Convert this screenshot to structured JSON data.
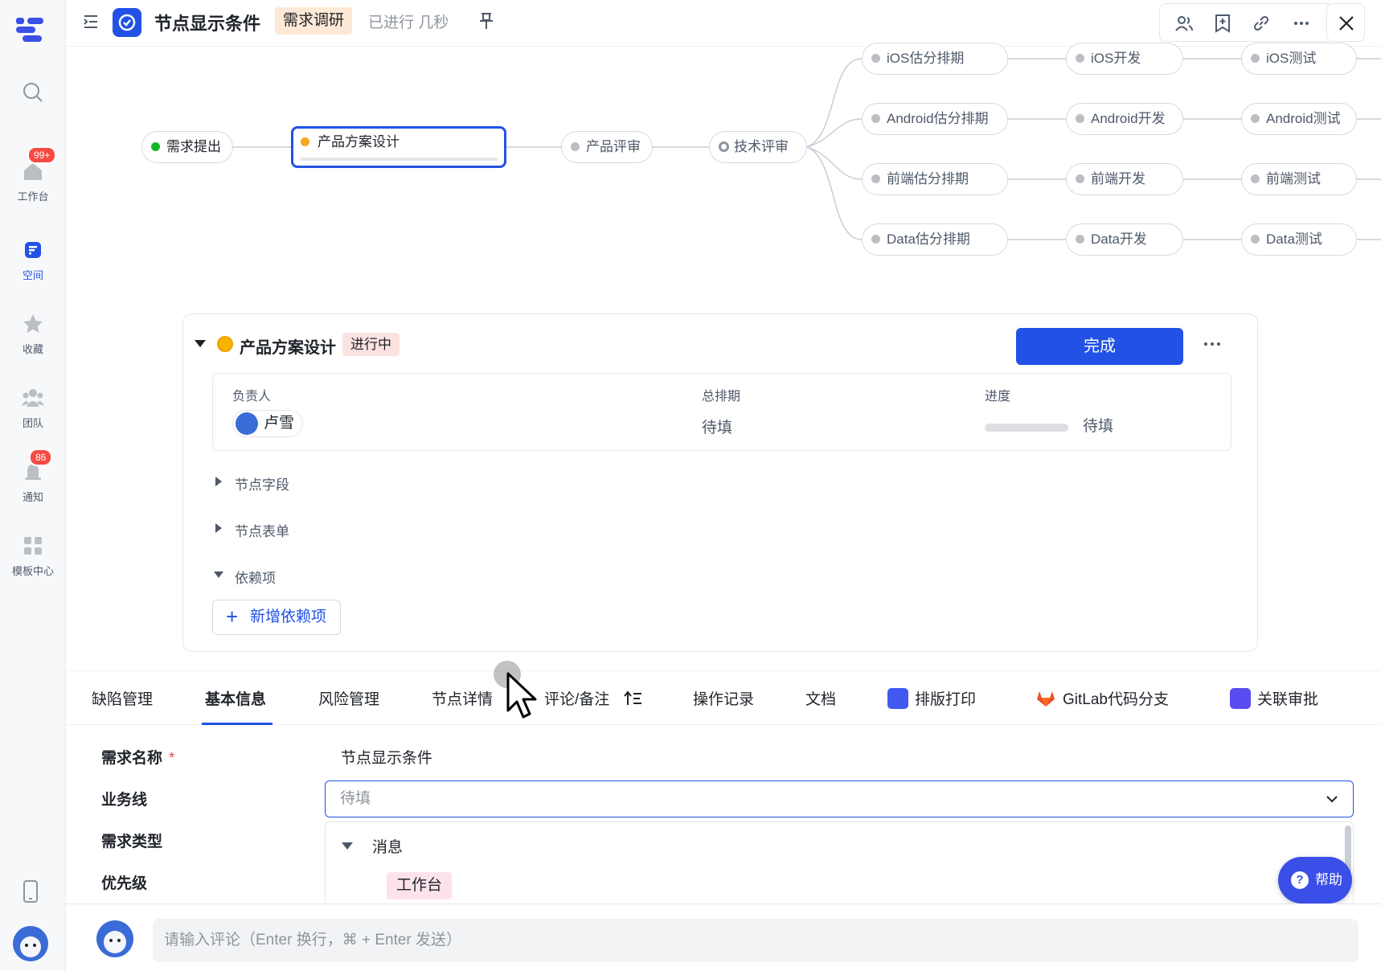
{
  "sidebar": {
    "items": [
      {
        "label": "",
        "icon": "search-icon"
      },
      {
        "label": "工作台",
        "icon": "workbench-icon",
        "badge": "99+"
      },
      {
        "label": "空间",
        "icon": "space-icon",
        "active": true
      },
      {
        "label": "收藏",
        "icon": "star-icon"
      },
      {
        "label": "团队",
        "icon": "team-icon"
      },
      {
        "label": "通知",
        "icon": "bell-icon",
        "badge": "86"
      },
      {
        "label": "模板中心",
        "icon": "template-icon"
      }
    ]
  },
  "header": {
    "title": "节点显示条件",
    "stage": "需求调研",
    "elapsed": "已进行 几秒"
  },
  "flow": {
    "nodes": {
      "n1": "需求提出",
      "n2": "产品方案设计",
      "n3": "产品评审",
      "n4": "技术评审",
      "ios_est": "iOS估分排期",
      "ios_dev": "iOS开发",
      "ios_test": "iOS测试",
      "and_est": "Android估分排期",
      "and_dev": "Android开发",
      "and_test": "Android测试",
      "fe_est": "前端估分排期",
      "fe_dev": "前端开发",
      "fe_test": "前端测试",
      "data_est": "Data估分排期",
      "data_dev": "Data开发",
      "data_test": "Data测试"
    }
  },
  "card": {
    "title": "产品方案设计",
    "status": "进行中",
    "done_button": "完成",
    "owner_label": "负责人",
    "owner_name": "卢雪",
    "schedule_label": "总排期",
    "schedule_value": "待填",
    "progress_label": "进度",
    "progress_value": "待填",
    "progress_fraction": 0,
    "sections": [
      "节点字段",
      "节点表单",
      "依赖项"
    ],
    "add_dependency": "新增依赖项"
  },
  "tabs": [
    "缺陷管理",
    "基本信息",
    "风险管理",
    "节点详情",
    "评论/备注",
    "操作记录",
    "文档",
    "排版打印",
    "GitLab代码分支",
    "关联审批"
  ],
  "active_tab": "基本信息",
  "form": {
    "name_label": "需求名称",
    "name_value": "节点显示条件",
    "bizline_label": "业务线",
    "bizline_placeholder": "待填",
    "type_label": "需求类型",
    "priority_label": "优先级",
    "dropdown_group": "消息",
    "dropdown_option": "工作台"
  },
  "help": "帮助",
  "comment": {
    "placeholder": "请输入评论（Enter 换行，⌘ + Enter 发送）"
  },
  "colors": {
    "accent": "#2251e6",
    "done_green": "#14b42a",
    "in_progress_orange": "#f5a623",
    "badge_red": "#f54a45"
  }
}
